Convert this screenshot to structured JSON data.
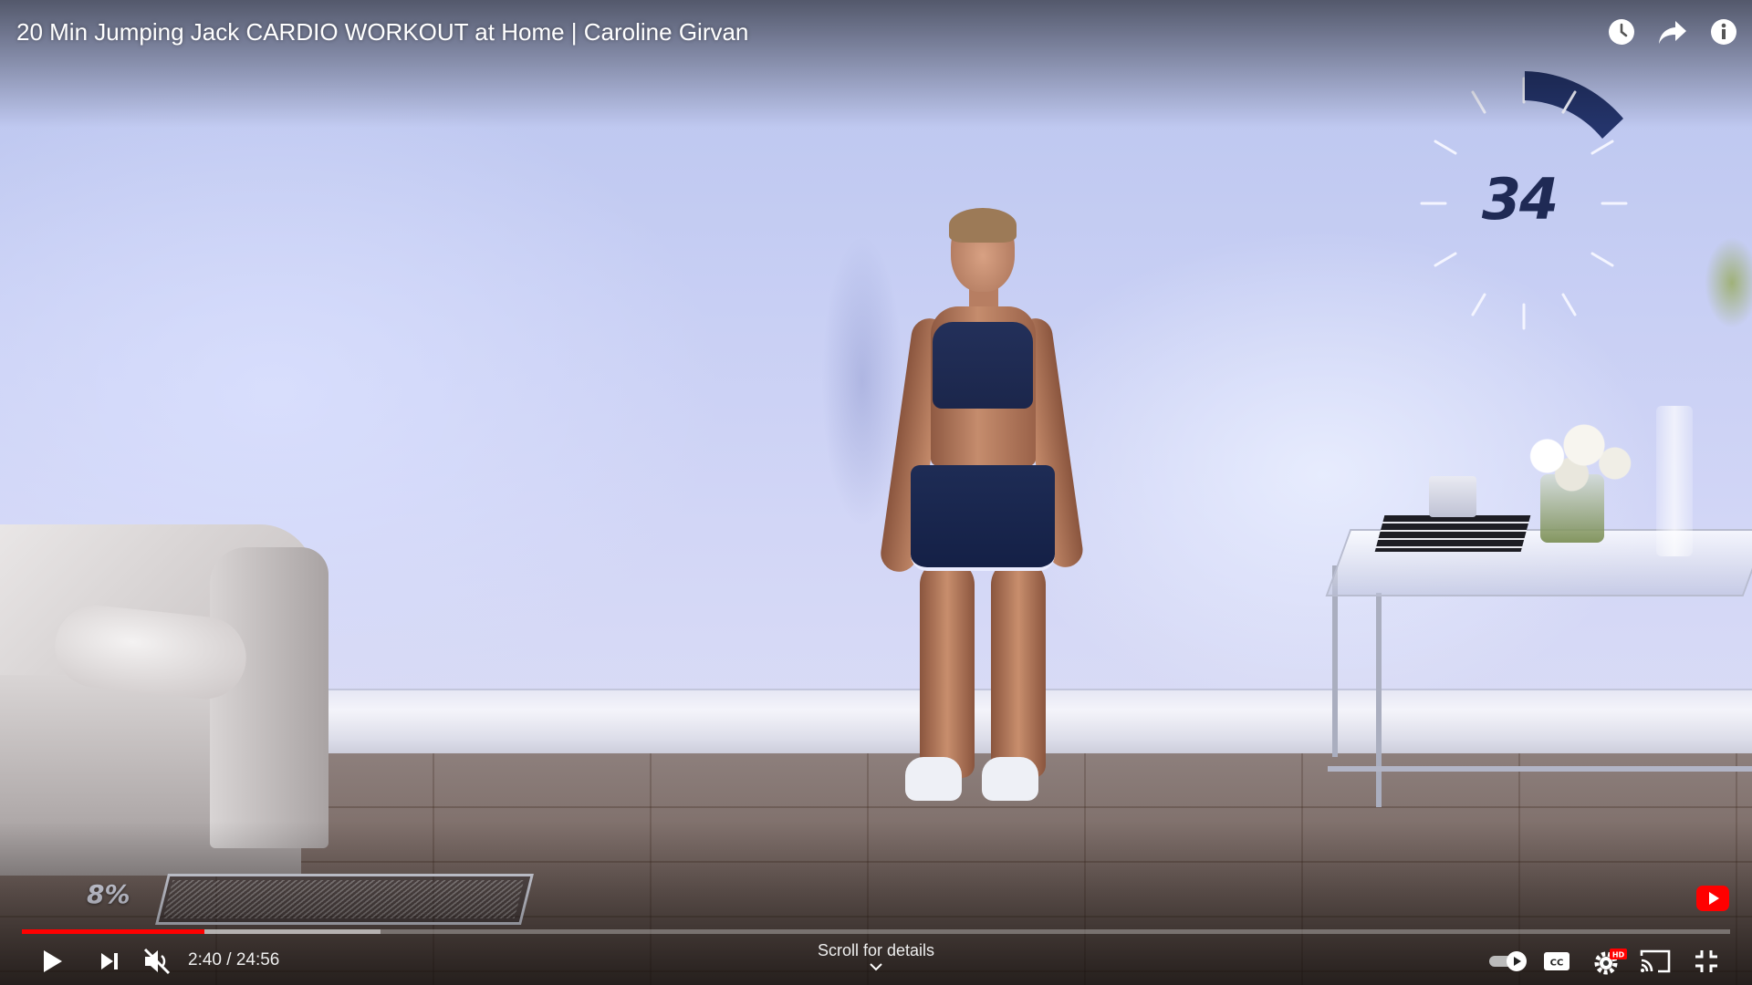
{
  "video": {
    "title": "20 Min Jumping Jack CARDIO WORKOUT at Home | Caroline Girvan",
    "progress_fraction": 0.107,
    "buffered_fraction": 0.103
  },
  "overlay_graphics": {
    "timer_value": "34",
    "timer_accent_color": "#24346b",
    "workout_percent": "8%",
    "workout_percent_value": 0.08
  },
  "top_actions": [
    {
      "icon": "watch-later-icon"
    },
    {
      "icon": "share-icon"
    },
    {
      "icon": "info-icon"
    }
  ],
  "controls": {
    "current_time": "2:40",
    "separator": " / ",
    "duration": "24:56",
    "scroll_details": "Scroll for details",
    "hd_badge": "HD",
    "autoplay": "on"
  },
  "colors": {
    "progress_played": "#ff0000",
    "youtube_red": "#ff0000"
  }
}
